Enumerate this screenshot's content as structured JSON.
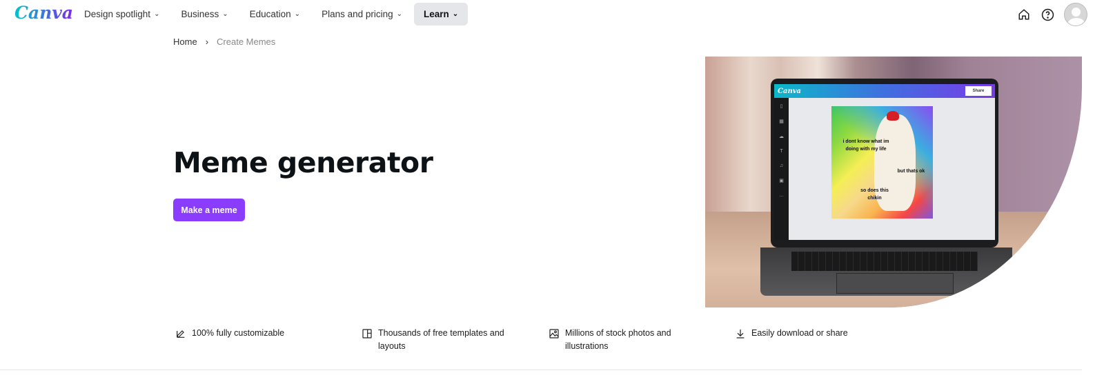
{
  "nav": {
    "logo": "Canva",
    "items": [
      {
        "label": "Design spotlight"
      },
      {
        "label": "Business"
      },
      {
        "label": "Education"
      },
      {
        "label": "Plans and pricing"
      },
      {
        "label": "Learn",
        "active": true
      }
    ]
  },
  "breadcrumb": {
    "home": "Home",
    "separator": "›",
    "current": "Create Memes"
  },
  "hero": {
    "title": "Meme generator",
    "cta": "Make a meme",
    "app_logo": "Canva",
    "share": "Share",
    "meme_texts": [
      "i dont know what im doing with my life",
      "but thats ok",
      "so does this chikin"
    ]
  },
  "features": [
    {
      "icon": "pencil-edit-icon",
      "text": "100% fully customizable"
    },
    {
      "icon": "template-layout-icon",
      "text": "Thousands of free templates and layouts"
    },
    {
      "icon": "image-icon",
      "text": "Millions of stock photos and illustrations"
    },
    {
      "icon": "download-icon",
      "text": "Easily download or share"
    }
  ],
  "colors": {
    "accent": "#8b3dff",
    "active_nav_bg": "#e4e6ea"
  }
}
